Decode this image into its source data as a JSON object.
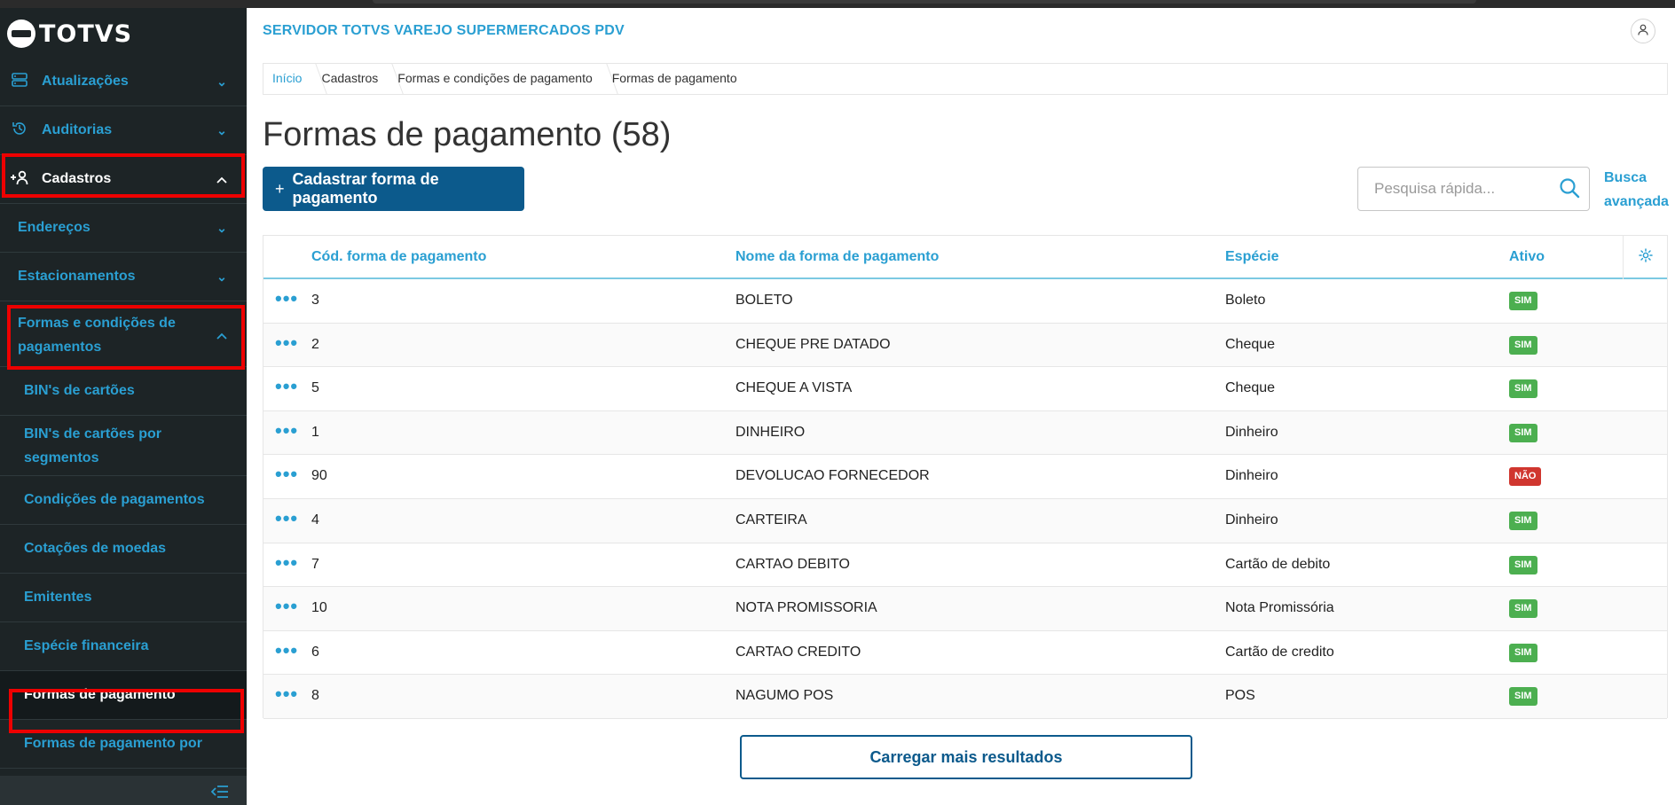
{
  "app": {
    "logo_text": "TOTVS",
    "header_title": "SERVIDOR TOTVS VAREJO SUPERMERCADOS PDV"
  },
  "sidebar": {
    "items": [
      {
        "label": "Atualizações",
        "icon": "server-icon",
        "chevron": "down"
      },
      {
        "label": "Auditorias",
        "icon": "history-icon",
        "chevron": "down"
      },
      {
        "label": "Cadastros",
        "icon": "add-user-icon",
        "chevron": "up",
        "active": true
      },
      {
        "label": "Endereços",
        "chevron": "down"
      },
      {
        "label": "Estacionamentos",
        "chevron": "down"
      },
      {
        "label": "Formas e condições de pagamentos",
        "chevron": "up"
      },
      {
        "label": "BIN's de cartões"
      },
      {
        "label": "BIN's de cartões por segmentos"
      },
      {
        "label": "Condições de pagamentos"
      },
      {
        "label": "Cotações de moedas"
      },
      {
        "label": "Emitentes"
      },
      {
        "label": "Espécie financeira"
      },
      {
        "label": "Formas de pagamento",
        "current": true
      },
      {
        "label": "Formas de pagamento por"
      }
    ]
  },
  "breadcrumb": [
    "Início",
    "Cadastros",
    "Formas e condições de pagamento",
    "Formas de pagamento"
  ],
  "page": {
    "title": "Formas de pagamento (58)",
    "add_button": "Cadastrar forma de pagamento",
    "search_placeholder": "Pesquisa rápida...",
    "advanced_search": "Busca avançada",
    "load_more": "Carregar mais resultados"
  },
  "table": {
    "columns": [
      "Cód. forma de pagamento",
      "Nome da forma de pagamento",
      "Espécie",
      "Ativo"
    ],
    "rows": [
      {
        "code": "3",
        "name": "BOLETO",
        "species": "Boleto",
        "active": "SIM"
      },
      {
        "code": "2",
        "name": "CHEQUE PRE DATADO",
        "species": "Cheque",
        "active": "SIM"
      },
      {
        "code": "5",
        "name": "CHEQUE A VISTA",
        "species": "Cheque",
        "active": "SIM"
      },
      {
        "code": "1",
        "name": "DINHEIRO",
        "species": "Dinheiro",
        "active": "SIM"
      },
      {
        "code": "90",
        "name": "DEVOLUCAO FORNECEDOR",
        "species": "Dinheiro",
        "active": "NÃO"
      },
      {
        "code": "4",
        "name": "CARTEIRA",
        "species": "Dinheiro",
        "active": "SIM"
      },
      {
        "code": "7",
        "name": "CARTAO DEBITO",
        "species": "Cartão de debito",
        "active": "SIM"
      },
      {
        "code": "10",
        "name": "NOTA PROMISSORIA",
        "species": "Nota Promissória",
        "active": "SIM"
      },
      {
        "code": "6",
        "name": "CARTAO CREDITO",
        "species": "Cartão de credito",
        "active": "SIM"
      },
      {
        "code": "8",
        "name": "NAGUMO POS",
        "species": "POS",
        "active": "SIM"
      }
    ]
  },
  "colors": {
    "accent": "#2a9fd2",
    "primary": "#0c5a8c",
    "badge_yes": "#4caf50",
    "badge_no": "#d0362f",
    "sidebar_bg": "#1d2426",
    "highlight": "#e00000"
  }
}
